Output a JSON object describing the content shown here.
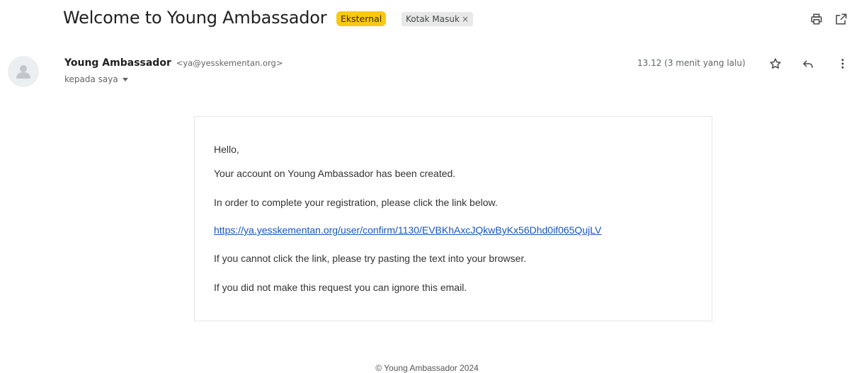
{
  "subject": {
    "title": "Welcome to Young Ambassador",
    "external_label": "Eksternal",
    "inbox_label": "Kotak Masuk",
    "inbox_remove": "×"
  },
  "toolbar": {
    "print_icon": "print-icon",
    "open_new_window_icon": "open-in-new-window-icon"
  },
  "sender": {
    "name": "Young Ambassador",
    "email": "<ya@yesskementan.org>",
    "to_label": "kepada saya",
    "time": "13.12 (3 menit yang lalu)"
  },
  "message_actions": {
    "star_icon": "star-icon",
    "reply_icon": "reply-icon",
    "more_icon": "more-vert-icon"
  },
  "body": {
    "greeting": "Hello,",
    "line1": "Your account on Young Ambassador has been created.",
    "line2": "In order to complete your registration, please click the link below.",
    "link": "https://ya.yesskementan.org/user/confirm/1130/EVBKhAxcJQkwByKx56Dhd0if065QujLV",
    "line3": "If you cannot click the link, please try pasting the text into your browser.",
    "line4": "If you did not make this request you can ignore this email."
  },
  "footer": {
    "copyright": "© Young Ambassador 2024"
  },
  "colors": {
    "external_badge": "#f9c812",
    "inbox_badge": "#e8e8e8",
    "link": "#1a55c0"
  }
}
